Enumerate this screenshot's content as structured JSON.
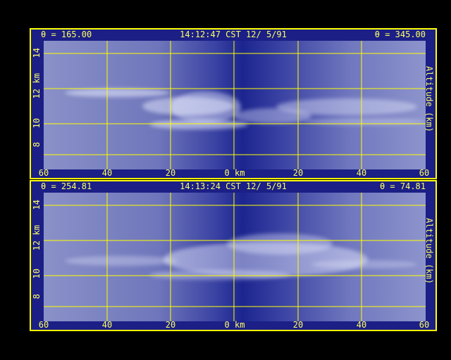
{
  "top": {
    "theta_left": "θ = 165.00",
    "timestamp": "14:12:47 CST 12/ 5/91",
    "theta_right": "θ = 345.00"
  },
  "bottom": {
    "theta_left": "θ = 254.81",
    "timestamp": "14:13:24 CST 12/ 5/91",
    "theta_right": "θ = 74.81"
  },
  "axes": {
    "y_ticks": [
      "8",
      "10",
      "12",
      "14"
    ],
    "y_unit": "km",
    "right_label": "Altitude (km)",
    "x_ticks": [
      "60",
      "40",
      "20",
      "0 km",
      "20",
      "40",
      "60"
    ]
  },
  "colors": {
    "frame": "#ffff00",
    "text": "#ffff66",
    "background": "#000000",
    "panel": "#1b1f86"
  }
}
